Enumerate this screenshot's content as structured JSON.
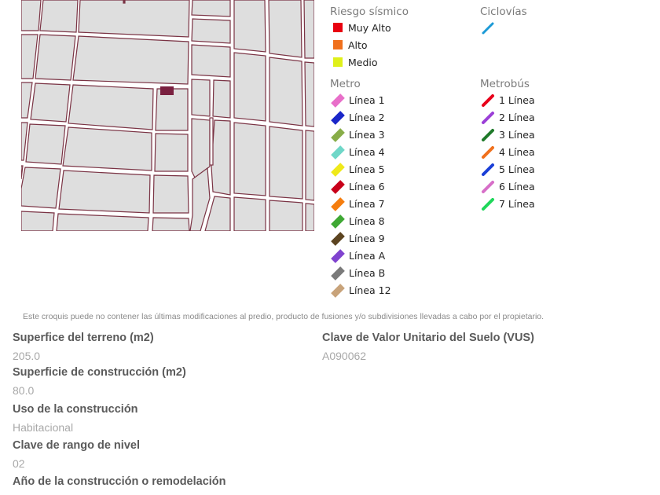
{
  "legend": {
    "seismic": {
      "title": "Riesgo sísmico",
      "items": [
        {
          "label": "Muy Alto",
          "color": "#e8000f"
        },
        {
          "label": "Alto",
          "color": "#f0701c"
        },
        {
          "label": "Medio",
          "color": "#dff01a"
        }
      ]
    },
    "bike": {
      "title": "Ciclovías",
      "items": [
        {
          "label": "",
          "color": "#1c9ad6",
          "icon": "bike-lane-line-icon"
        }
      ]
    },
    "metro": {
      "title": "Metro",
      "items": [
        {
          "label": "Línea 1",
          "color": "#e86fc9"
        },
        {
          "label": "Línea 2",
          "color": "#1a26c8"
        },
        {
          "label": "Línea 3",
          "color": "#88ad48"
        },
        {
          "label": "Línea 4",
          "color": "#6fd7c8"
        },
        {
          "label": "Línea 5",
          "color": "#efe91a"
        },
        {
          "label": "Línea 6",
          "color": "#c8001a"
        },
        {
          "label": "Línea 7",
          "color": "#f57d0e"
        },
        {
          "label": "Línea 8",
          "color": "#3fa834"
        },
        {
          "label": "Línea 9",
          "color": "#5c4420"
        },
        {
          "label": "Línea A",
          "color": "#8043cf"
        },
        {
          "label": "Línea B",
          "color": "#7a7a7a"
        },
        {
          "label": "Línea 12",
          "color": "#c8a37a"
        }
      ]
    },
    "metrobus": {
      "title": "Metrobús",
      "items": [
        {
          "label": "1 Línea",
          "color": "#e8001a"
        },
        {
          "label": "2 Línea",
          "color": "#9b3fd7"
        },
        {
          "label": "3 Línea",
          "color": "#1f7a2a"
        },
        {
          "label": "4 Línea",
          "color": "#f0701c"
        },
        {
          "label": "5 Línea",
          "color": "#1a3fd7"
        },
        {
          "label": "6 Línea",
          "color": "#d76fc8"
        },
        {
          "label": "7 Línea",
          "color": "#1fd75a"
        }
      ]
    }
  },
  "map": {
    "block_fill": "#dedede",
    "street_edge": "#7a3344",
    "parcel_color": "#7a2040"
  },
  "disclaimer": "Este croquis puede no contener las últimas modificaciones al predio, producto de fusiones y/o subdivisiones llevadas a cabo por el propietario.",
  "fields_left": [
    {
      "label": "Superfice del terreno (m2)",
      "value": "205.0"
    },
    {
      "label": "Superficie de construcción (m2)",
      "value": "80.0"
    },
    {
      "label": "Uso de la construcción",
      "value": "Habitacional"
    },
    {
      "label": "Clave de rango de nivel",
      "value": "02"
    },
    {
      "label": "Año de la construcción o remodelación",
      "value": ""
    }
  ],
  "fields_right": [
    {
      "label": "Clave de Valor Unitario del Suelo (VUS)",
      "value": "A090062"
    }
  ]
}
